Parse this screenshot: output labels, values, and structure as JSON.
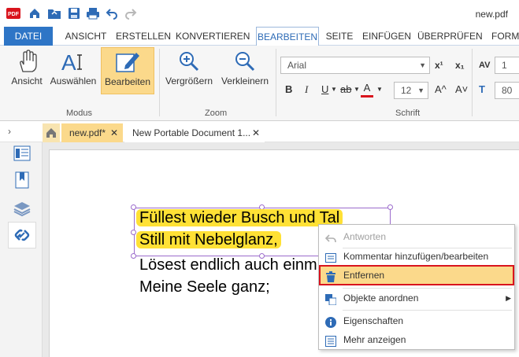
{
  "window": {
    "filename": "new.pdf",
    "logo_text": "PDF"
  },
  "menu": {
    "tabs": [
      "DATEI",
      "ANSICHT",
      "ERSTELLEN",
      "KONVERTIEREN",
      "BEARBEITEN",
      "SEITE",
      "EINFÜGEN",
      "ÜBERPRÜFEN",
      "FORM"
    ],
    "active": "BEARBEITEN"
  },
  "ribbon": {
    "modus": {
      "label": "Modus",
      "buttons": [
        "Ansicht",
        "Auswählen",
        "Bearbeiten"
      ],
      "selected": "Bearbeiten"
    },
    "zoom": {
      "label": "Zoom",
      "buttons": [
        "Vergrößern",
        "Verkleinern"
      ]
    },
    "schrift": {
      "label": "Schrift",
      "font": "Arial",
      "size": "12",
      "superscript": "x¹",
      "subscript": "x₁",
      "grow": "A^",
      "shrink": "A˅"
    },
    "extra": {
      "spacing_value": "1",
      "indent_value": "80"
    }
  },
  "doc_tabs": [
    {
      "label": "new.pdf*",
      "active": true
    },
    {
      "label": "New Portable Document 1...",
      "active": false
    }
  ],
  "document": {
    "lines": [
      "Füllest wieder Busch und Tal",
      "Still mit Nebelglanz,",
      "Lösest endlich auch einm",
      "Meine Seele ganz;"
    ]
  },
  "context_menu": {
    "items": [
      {
        "label": "Antworten",
        "disabled": true,
        "icon": "reply-icon"
      },
      {
        "label": "Kommentar hinzufügen/bearbeiten",
        "icon": "comment-icon"
      },
      {
        "label": "Entfernen",
        "icon": "trash-icon",
        "highlighted": true
      },
      {
        "label": "Objekte anordnen",
        "icon": "arrange-icon",
        "submenu": true
      },
      {
        "label": "Eigenschaften",
        "icon": "info-icon"
      },
      {
        "label": "Mehr anzeigen",
        "icon": "list-icon"
      }
    ]
  },
  "colors": {
    "accent": "#2e75c6",
    "selection": "#fbd98b",
    "highlight": "#ffe135",
    "alert": "#d9141d"
  }
}
